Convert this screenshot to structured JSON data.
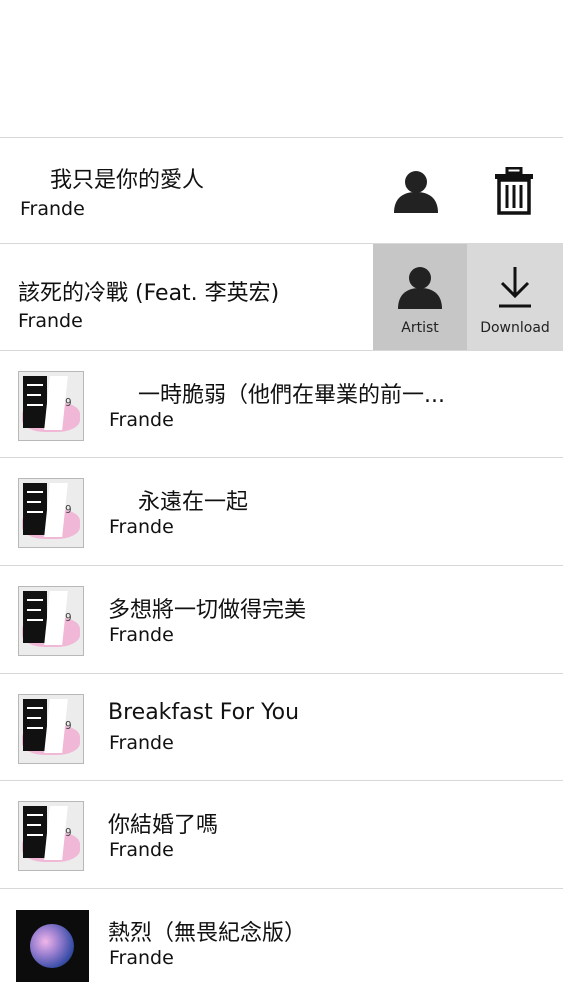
{
  "rows": [
    {
      "title": "我只是你的愛人",
      "artist": "Frande",
      "state": "swiped",
      "actions": [
        "artist",
        "delete"
      ]
    },
    {
      "title": "該死的冷戰 (Feat. 李英宏)",
      "artist": "Frande",
      "state": "swiped",
      "actions": [
        {
          "label": "Artist",
          "icon": "person-icon"
        },
        {
          "label": "Download",
          "icon": "download-icon"
        }
      ]
    },
    {
      "title": "一時脆弱（他們在畢業的前一...",
      "artist": "Frande",
      "thumb": "album-cover-icon"
    },
    {
      "title": "永遠在一起",
      "artist": "Frande",
      "thumb": "album-cover-icon"
    },
    {
      "title": "多想將一切做得完美",
      "artist": "Frande",
      "thumb": "album-cover-icon"
    },
    {
      "title": "Breakfast For You",
      "artist": "Frande",
      "thumb": "album-cover-icon"
    },
    {
      "title": "你結婚了嗎",
      "artist": "Frande",
      "thumb": "album-cover-icon"
    },
    {
      "title": "熱烈（無畏紀念版）",
      "artist": "Frande",
      "thumb": "planet-cover-icon"
    }
  ],
  "colors": {
    "action_artist_bg": "#c6c6c6",
    "action_download_bg": "#d9d9d9",
    "divider": "#d8d8d8"
  }
}
